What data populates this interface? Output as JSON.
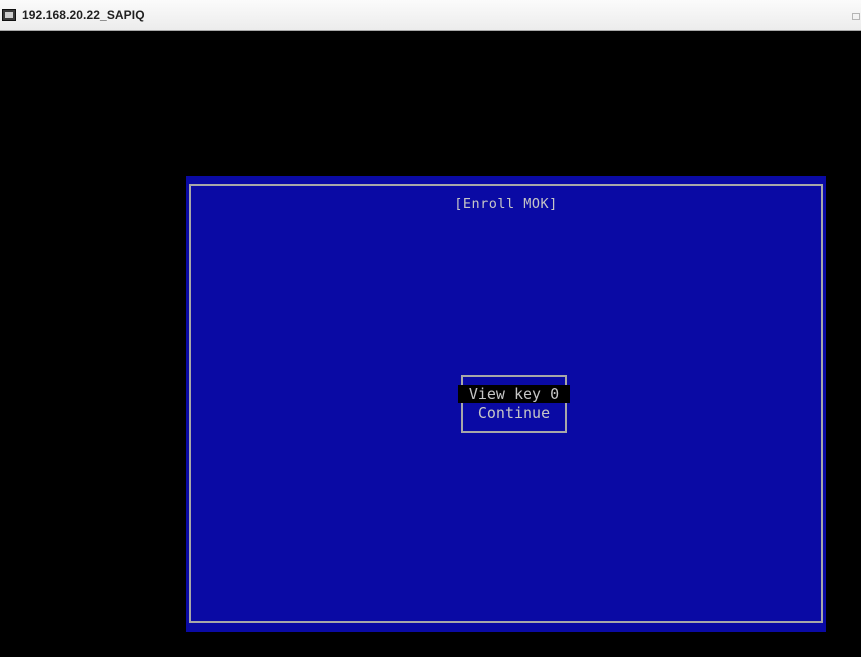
{
  "window": {
    "title": "192.168.20.22_SAPIQ",
    "icon": "console-window-icon",
    "restore_icon": "restore-icon"
  },
  "mok": {
    "title": "[Enroll MOK]",
    "menu": [
      {
        "label": "View key 0",
        "selected": true
      },
      {
        "label": "Continue",
        "selected": false
      }
    ]
  },
  "colors": {
    "panel_background": "#0a0aa4",
    "screen_background": "#000000",
    "text": "#c6c6c6",
    "frame": "#a8a8a8",
    "selection_background": "#000000"
  }
}
